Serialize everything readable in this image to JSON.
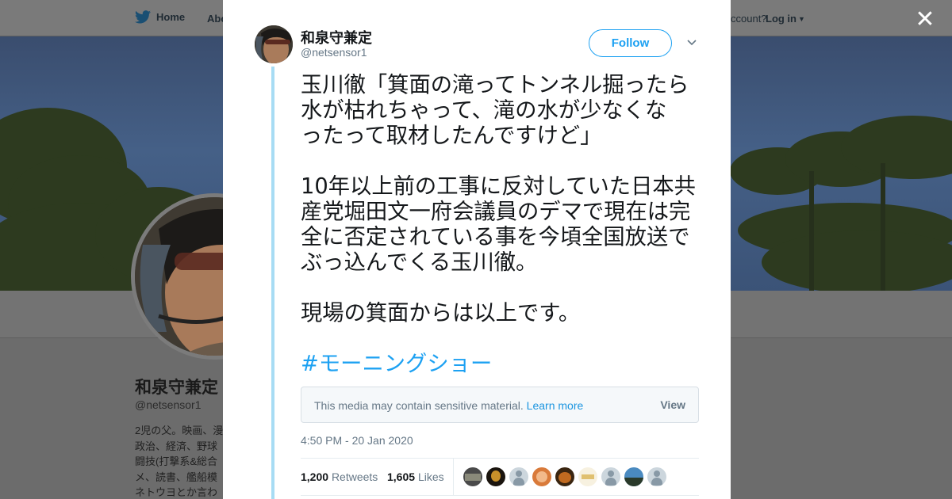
{
  "nav": {
    "home_label": "Home",
    "about_label": "Abo",
    "account_text": "ccount?",
    "login_label": "Log in"
  },
  "profile": {
    "name": "和泉守兼定",
    "handle": "@netsensor1",
    "bio_lines": [
      "2児の父。映画、漫",
      "政治、経済、野球",
      "闘技(打撃系&総合",
      "メ、読書、艦船模",
      "ネトウヨとか言わ"
    ]
  },
  "tweet": {
    "author_name": "和泉守兼定",
    "author_handle": "@netsensor1",
    "follow_label": "Follow",
    "text_lines": [
      "玉川徹「箕面の滝ってトンネル掘ったら",
      "水が枯れちゃって、滝の水が少なくな",
      "ったって取材したんですけど」",
      "",
      "10年以上前の工事に反対していた日本共",
      "産党堀田文一府会議員のデマで現在は完",
      "全に否定されている事を今頃全国放送で",
      "ぶっ込んでくる玉川徹。",
      "",
      "現場の箕面からは以上です。",
      ""
    ],
    "hashtag": "#モーニングショー",
    "media_warning": "This media may contain sensitive material.",
    "media_learn_more": "Learn more",
    "media_view": "View",
    "timestamp": "4:50 PM - 20 Jan 2020",
    "retweets_count": "1,200",
    "retweets_label": "Retweets",
    "likes_count": "1,605",
    "likes_label": "Likes"
  },
  "icons": {
    "twitter": "twitter-bird-icon",
    "close": "close-icon",
    "caret": "chevron-down-icon"
  },
  "colors": {
    "accent": "#1da1f2",
    "thread_line": "#a7dcf4",
    "secondary_text": "#657786"
  }
}
